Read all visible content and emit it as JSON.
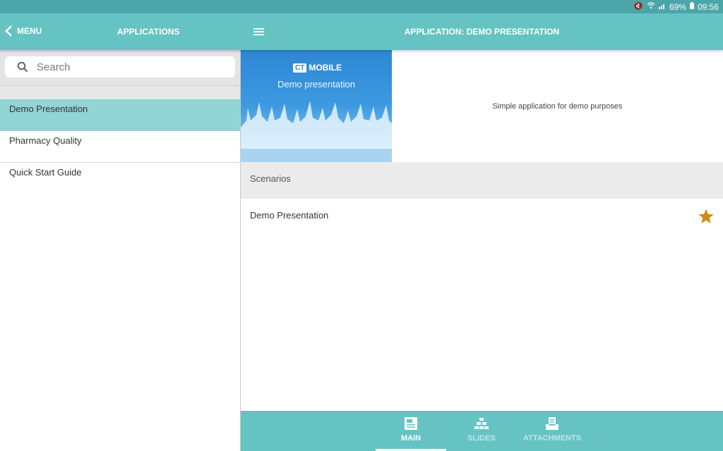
{
  "status_bar": {
    "battery": "69%",
    "time": "09:56",
    "icons": [
      "mute-icon",
      "wifi-icon",
      "signal-icon",
      "battery-icon"
    ]
  },
  "app_bar": {
    "back_label": "MENU",
    "left_title": "APPLICATIONS",
    "main_title": "APPLICATION: DEMO PRESENTATION",
    "color": "#66c3c4"
  },
  "sidebar": {
    "search_placeholder": "Search",
    "items": [
      {
        "label": "Demo Presentation",
        "selected": true
      },
      {
        "label": "Pharmacy Quality",
        "selected": false
      },
      {
        "label": "Quick Start Guide",
        "selected": false
      }
    ],
    "selected_color": "#92d3d3"
  },
  "main": {
    "hero": {
      "logo_ct": "CT",
      "logo_text": "MOBILE",
      "subtitle": "Demo presentation"
    },
    "description": "Simple application for demo purposes",
    "section_title": "Scenarios",
    "scenarios": [
      {
        "label": "Demo Presentation",
        "favorite": true
      }
    ],
    "star_color": "#d18b12"
  },
  "bottom_nav": {
    "tabs": [
      {
        "label": "MAIN",
        "icon": "document-icon",
        "active": true
      },
      {
        "label": "SLIDES",
        "icon": "slides-icon",
        "active": false
      },
      {
        "label": "ATTACHMENTS",
        "icon": "attachments-icon",
        "active": false
      }
    ]
  }
}
